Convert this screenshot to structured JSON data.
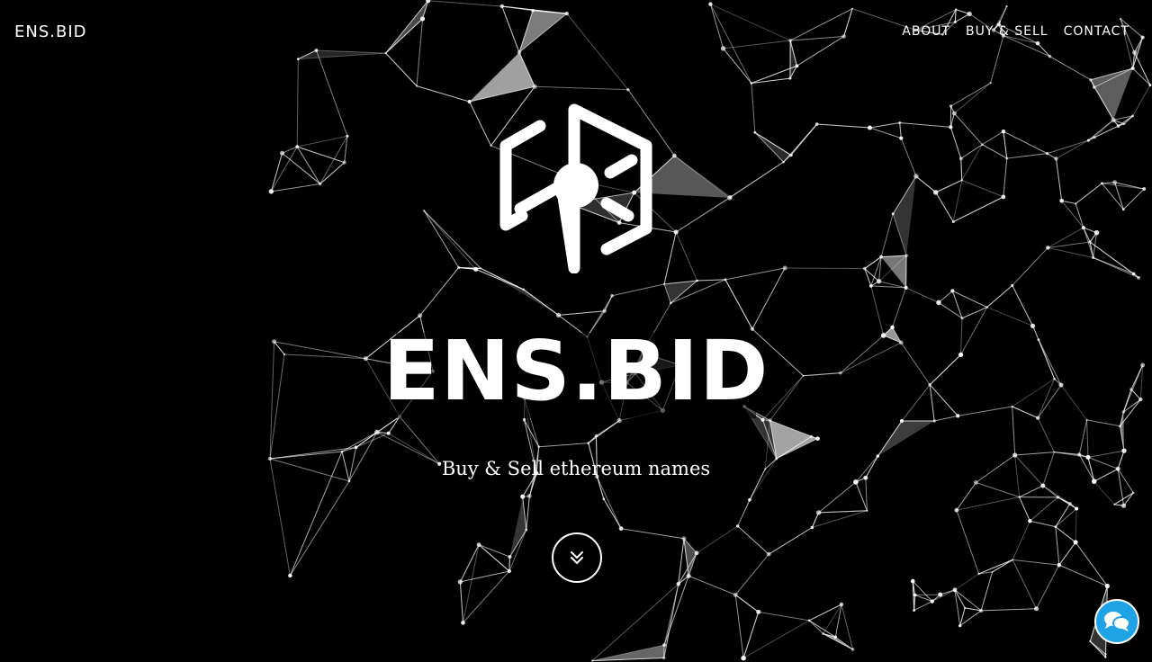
{
  "header": {
    "brand": "ENS.BID",
    "nav": [
      {
        "label": "ABOUT"
      },
      {
        "label": "BUY & SELL"
      },
      {
        "label": "CONTACT"
      }
    ]
  },
  "hero": {
    "title": "ENS.BID",
    "tagline": "Buy & Sell ethereum names"
  },
  "icons": {
    "logo": "ens-logo-icon",
    "scroll": "chevron-double-down-icon",
    "chat": "chat-bubbles-icon"
  },
  "colors": {
    "background": "#000000",
    "foreground": "#ffffff",
    "chat_accent": "#1fa3e6"
  }
}
